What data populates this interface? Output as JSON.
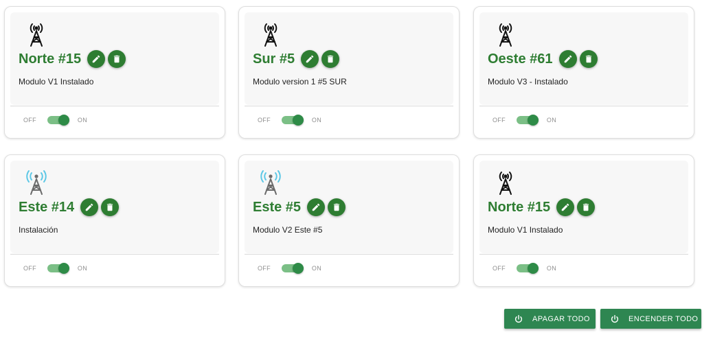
{
  "antennas": [
    {
      "title": "Norte #15",
      "description": "Modulo V1 Instalado",
      "icon": "antenna-black-icon",
      "switch_on": true
    },
    {
      "title": "Sur #5",
      "description": "Modulo version 1 #5 SUR",
      "icon": "antenna-black-icon",
      "switch_on": true
    },
    {
      "title": "Oeste #61",
      "description": "Modulo V3 - Instalado",
      "icon": "antenna-black-icon",
      "switch_on": true
    },
    {
      "title": "Este #14",
      "description": "Instalación",
      "icon": "antenna-signal-blue-icon",
      "switch_on": true
    },
    {
      "title": "Este #5",
      "description": "Modulo V2 Este #5",
      "icon": "antenna-signal-blue-icon",
      "switch_on": true
    },
    {
      "title": "Norte #15",
      "description": "Modulo V1 Instalado",
      "icon": "antenna-black-icon",
      "switch_on": true
    }
  ],
  "switch_labels": {
    "off": "OFF",
    "on": "ON"
  },
  "actions": {
    "turn_off_all": "APAGAR TODO",
    "turn_on_all": "ENCENDER TODO"
  },
  "colors": {
    "title_green": "#2e7d32",
    "button_green": "#2e8651",
    "signal_blue": "#5ec8e6"
  },
  "icons": {
    "edit": "pencil-icon",
    "delete": "trash-icon",
    "power": "power-icon"
  }
}
